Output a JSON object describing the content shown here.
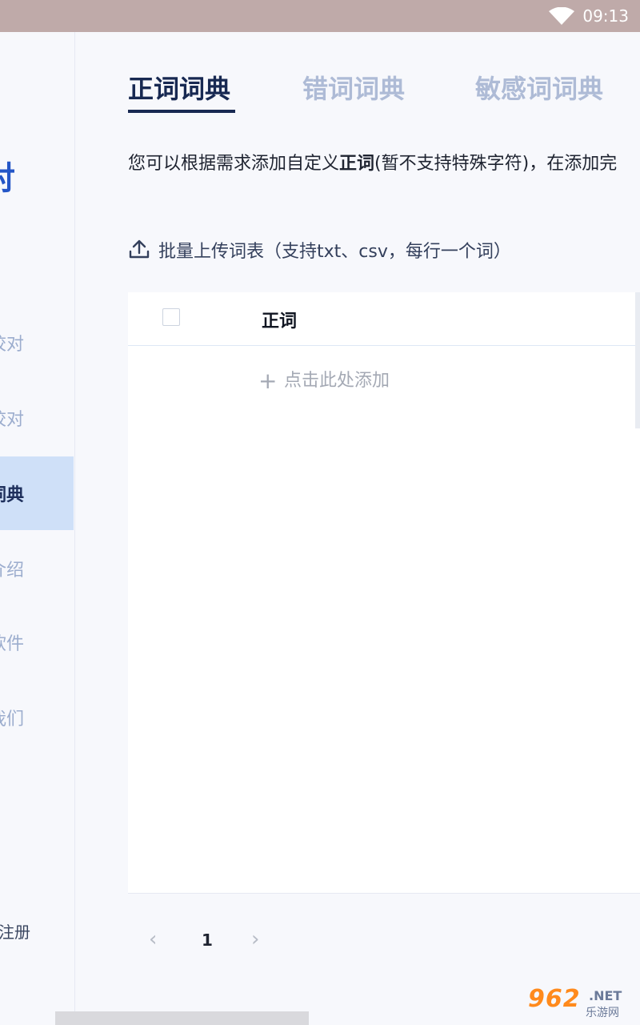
{
  "status_bar": {
    "time": "09:13",
    "wifi_icon": "wifi-icon"
  },
  "sidebar": {
    "brand": "对",
    "items": [
      {
        "label": "校对",
        "active": false
      },
      {
        "label": "校对",
        "active": false
      },
      {
        "label": "词典",
        "active": true
      },
      {
        "label": "介绍",
        "active": false
      },
      {
        "label": "软件",
        "active": false
      },
      {
        "label": "我们",
        "active": false
      }
    ],
    "register": "注册"
  },
  "tabs": [
    {
      "label": "正词词典",
      "active": true
    },
    {
      "label": "错词词典",
      "active": false
    },
    {
      "label": "敏感词词典",
      "active": false
    }
  ],
  "description": {
    "prefix": "您可以根据需求添加自定义",
    "bold": "正词",
    "suffix": "(暂不支持特殊字符)，在添加完"
  },
  "upload": {
    "label": "批量上传词表（支持txt、csv，每行一个词）",
    "icon": "upload-icon"
  },
  "table": {
    "column_header": "正词",
    "add_row_label": "点击此处添加",
    "rows": []
  },
  "pagination": {
    "current_page": "1",
    "prev_icon": "chevron-left-icon",
    "next_icon": "chevron-right-icon"
  },
  "watermark": {
    "brand": "962",
    "net": ".NET",
    "sub": "乐游网"
  },
  "colors": {
    "accent": "#182952",
    "active_bg": "#cfe0f8",
    "brand_blue": "#2456c7"
  }
}
